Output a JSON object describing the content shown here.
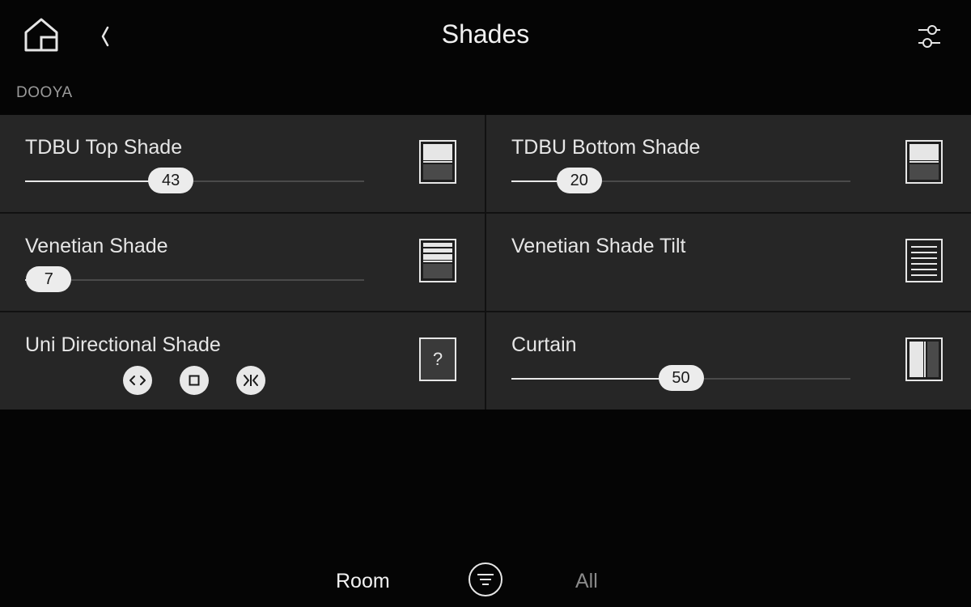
{
  "header": {
    "title": "Shades",
    "home_icon": "home-icon",
    "back_icon": "chevron-left-icon",
    "settings_icon": "sliders-icon"
  },
  "section": {
    "label": "DOOYA"
  },
  "cards": {
    "tdbu_top": {
      "title": "TDBU Top Shade",
      "value": "43",
      "level": 43,
      "icon": "shade-icon"
    },
    "tdbu_bottom": {
      "title": "TDBU Bottom Shade",
      "value": "20",
      "level": 20,
      "icon": "shade-icon"
    },
    "venetian": {
      "title": "Venetian Shade",
      "value": "7",
      "level": 7,
      "icon": "venetian-shade-icon"
    },
    "venetian_tilt": {
      "title": "Venetian Shade Tilt",
      "icon": "blinds-icon",
      "buttons": [
        "tilt-open-icon",
        "tilt-close-icon"
      ]
    },
    "uni_directional": {
      "title": "Uni Directional Shade",
      "icon": "unknown-device-icon",
      "icon_glyph": "?",
      "buttons": [
        "open-icon",
        "stop-icon",
        "close-icon"
      ]
    },
    "curtain": {
      "title": "Curtain",
      "value": "50",
      "level": 50,
      "icon": "curtain-icon"
    }
  },
  "footer": {
    "room_label": "Room",
    "all_label": "All",
    "filter_icon": "filter-icon"
  },
  "colors": {
    "background": "#050505",
    "card": "#262626",
    "accent": "#e8e8e8",
    "muted": "#8a8a8a"
  }
}
